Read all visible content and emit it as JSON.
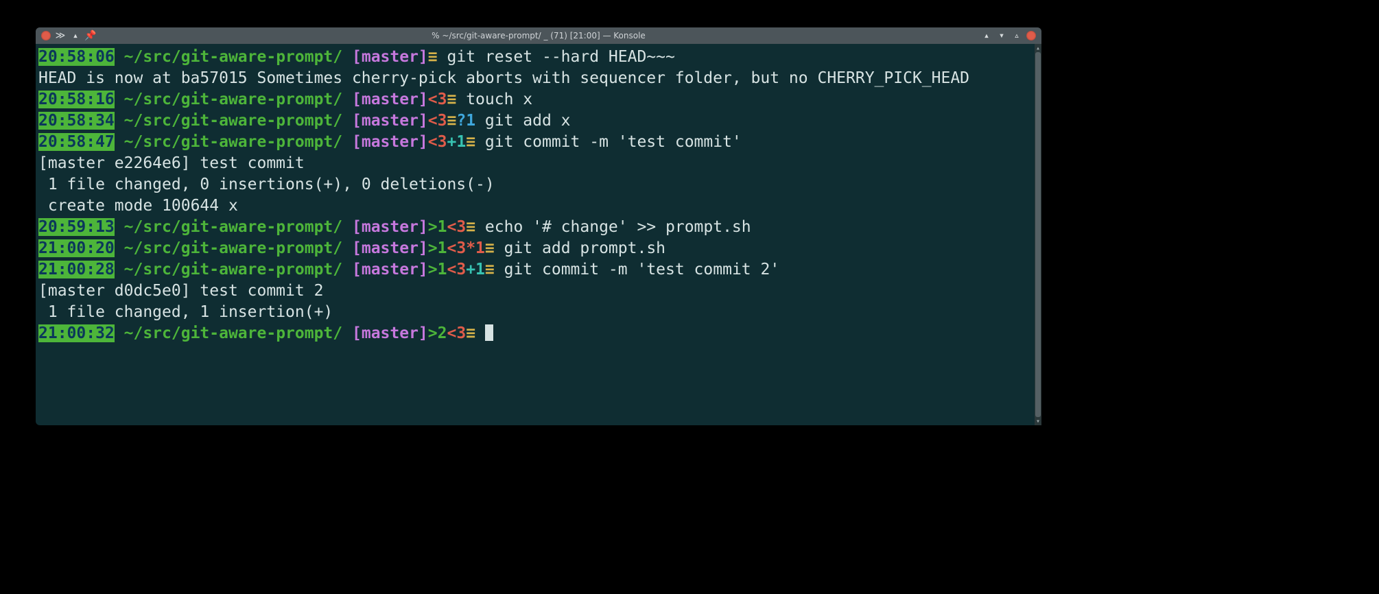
{
  "window": {
    "title": "% ~/src/git-aware-prompt/ _ (71) [21:00] — Konsole"
  },
  "cwd": "~/src/git-aware-prompt/",
  "branch": "master",
  "glyph_clean": "≡",
  "entries": [
    {
      "type": "prompt",
      "ts": "20:58:06",
      "status": [
        {
          "cls": "clean",
          "txt": "≡"
        }
      ],
      "cmd": "git reset --hard HEAD~~~"
    },
    {
      "type": "out",
      "text": "HEAD is now at ba57015 Sometimes cherry-pick aborts with sequencer folder, but no CHERRY_PICK_HEAD"
    },
    {
      "type": "prompt",
      "ts": "20:58:16",
      "status": [
        {
          "cls": "behind",
          "txt": "<3"
        },
        {
          "cls": "clean",
          "txt": "≡"
        }
      ],
      "cmd": "touch x"
    },
    {
      "type": "prompt",
      "ts": "20:58:34",
      "status": [
        {
          "cls": "behind",
          "txt": "<3"
        },
        {
          "cls": "clean",
          "txt": "≡"
        },
        {
          "cls": "untrk",
          "txt": "?1"
        }
      ],
      "cmd": "git add x"
    },
    {
      "type": "prompt",
      "ts": "20:58:47",
      "status": [
        {
          "cls": "behind",
          "txt": "<3"
        },
        {
          "cls": "stage",
          "txt": "+1"
        },
        {
          "cls": "clean",
          "txt": "≡"
        }
      ],
      "cmd": "git commit -m 'test commit'"
    },
    {
      "type": "out",
      "text": "[master e2264e6] test commit"
    },
    {
      "type": "out",
      "text": " 1 file changed, 0 insertions(+), 0 deletions(-)"
    },
    {
      "type": "out",
      "text": " create mode 100644 x"
    },
    {
      "type": "prompt",
      "ts": "20:59:13",
      "status": [
        {
          "cls": "ahead",
          "txt": ">1"
        },
        {
          "cls": "behind",
          "txt": "<3"
        },
        {
          "cls": "clean",
          "txt": "≡"
        }
      ],
      "cmd": "echo '# change' >> prompt.sh"
    },
    {
      "type": "prompt",
      "ts": "21:00:20",
      "status": [
        {
          "cls": "ahead",
          "txt": ">1"
        },
        {
          "cls": "behind",
          "txt": "<3"
        },
        {
          "cls": "dirty",
          "txt": "*1"
        },
        {
          "cls": "clean",
          "txt": "≡"
        }
      ],
      "cmd": "git add prompt.sh"
    },
    {
      "type": "prompt",
      "ts": "21:00:28",
      "status": [
        {
          "cls": "ahead",
          "txt": ">1"
        },
        {
          "cls": "behind",
          "txt": "<3"
        },
        {
          "cls": "stage",
          "txt": "+1"
        },
        {
          "cls": "clean",
          "txt": "≡"
        }
      ],
      "cmd": "git commit -m 'test commit 2'"
    },
    {
      "type": "out",
      "text": "[master d0dc5e0] test commit 2"
    },
    {
      "type": "out",
      "text": " 1 file changed, 1 insertion(+)"
    },
    {
      "type": "prompt",
      "ts": "21:00:32",
      "status": [
        {
          "cls": "ahead",
          "txt": ">2"
        },
        {
          "cls": "behind",
          "txt": "<3"
        },
        {
          "cls": "clean",
          "txt": "≡"
        }
      ],
      "cmd": "",
      "cursor": true
    }
  ]
}
